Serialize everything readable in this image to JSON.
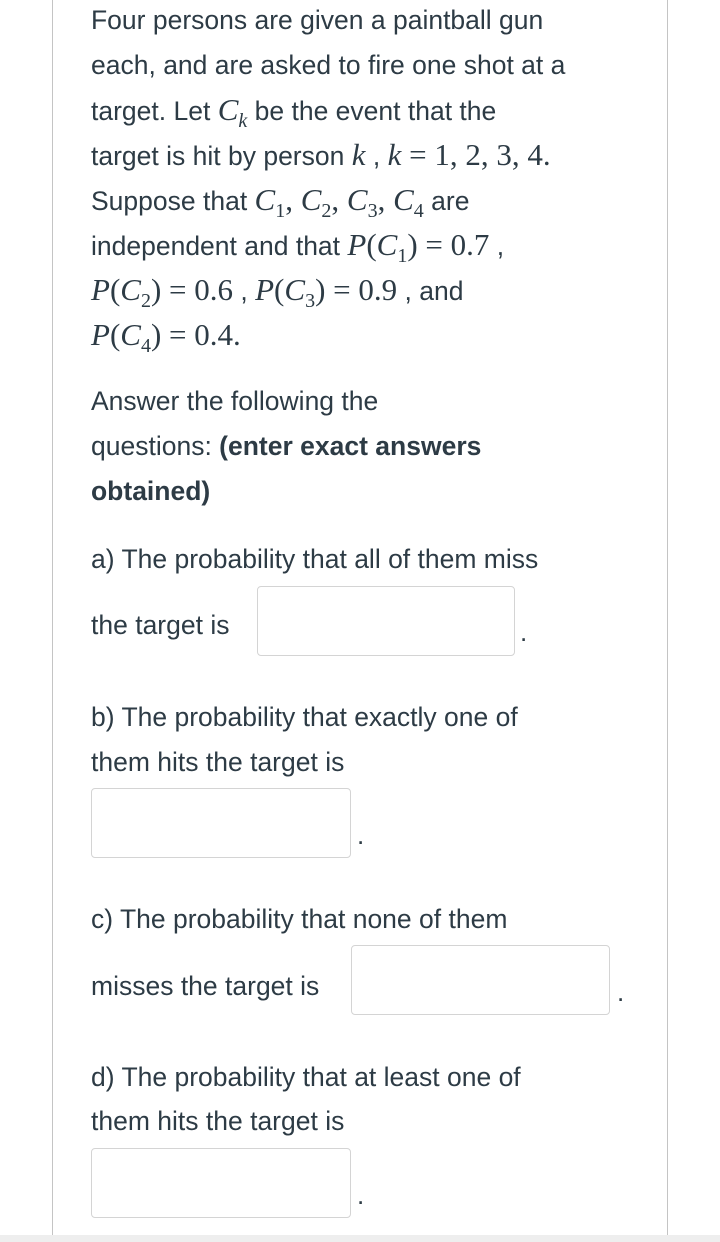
{
  "intro": [
    [
      {
        "t": "Four persons are given a paintball gun"
      }
    ],
    [
      {
        "t": "each, and are asked to fire one shot at a"
      }
    ],
    [
      {
        "t": "target. Let "
      },
      {
        "m": "C",
        "sub": "k",
        "subItalic": true
      },
      {
        "t": " be the event that the"
      }
    ],
    [
      {
        "t": "target is hit by person "
      },
      {
        "m": "k"
      },
      {
        "t": " , "
      },
      {
        "m": "k"
      },
      {
        "r": " = 1, 2, 3, 4."
      }
    ],
    [
      {
        "t": "Suppose that "
      },
      {
        "m": "C",
        "sub": "1"
      },
      {
        "r": ", "
      },
      {
        "m": "C",
        "sub": "2"
      },
      {
        "r": ", "
      },
      {
        "m": "C",
        "sub": "3"
      },
      {
        "r": ", "
      },
      {
        "m": "C",
        "sub": "4"
      },
      {
        "t": " are"
      }
    ],
    [
      {
        "t": "independent and that "
      },
      {
        "m": "P"
      },
      {
        "r": "("
      },
      {
        "m": "C",
        "sub": "1"
      },
      {
        "r": ") = 0.7"
      },
      {
        "t": " ,"
      }
    ],
    [
      {
        "m": "P"
      },
      {
        "r": "("
      },
      {
        "m": "C",
        "sub": "2"
      },
      {
        "r": ") = 0.6"
      },
      {
        "t": " , "
      },
      {
        "m": "P"
      },
      {
        "r": "("
      },
      {
        "m": "C",
        "sub": "3"
      },
      {
        "r": ") = 0.9"
      },
      {
        "t": " , and"
      }
    ],
    [
      {
        "m": "P"
      },
      {
        "r": "("
      },
      {
        "m": "C",
        "sub": "4"
      },
      {
        "r": ") = 0.4."
      }
    ]
  ],
  "instructions": [
    [
      {
        "t": "Answer the following the"
      }
    ],
    [
      {
        "t": "questions: "
      },
      {
        "b": "(enter exact answers"
      }
    ],
    [
      {
        "b": "obtained)"
      }
    ]
  ],
  "questions": {
    "a": {
      "lines": [
        "a) The probability that all of them miss",
        "the target is"
      ],
      "value": "",
      "suffix": "."
    },
    "b": {
      "lines": [
        "b) The probability that exactly one of",
        "them hits the target is"
      ],
      "value": "",
      "suffix": "."
    },
    "c": {
      "lines": [
        "c) The probability that none of them",
        "misses the target is"
      ],
      "value": "",
      "suffix": "."
    },
    "d": {
      "lines": [
        "d) The probability that at least one of",
        "them hits the target is"
      ],
      "value": "",
      "suffix": "."
    }
  }
}
